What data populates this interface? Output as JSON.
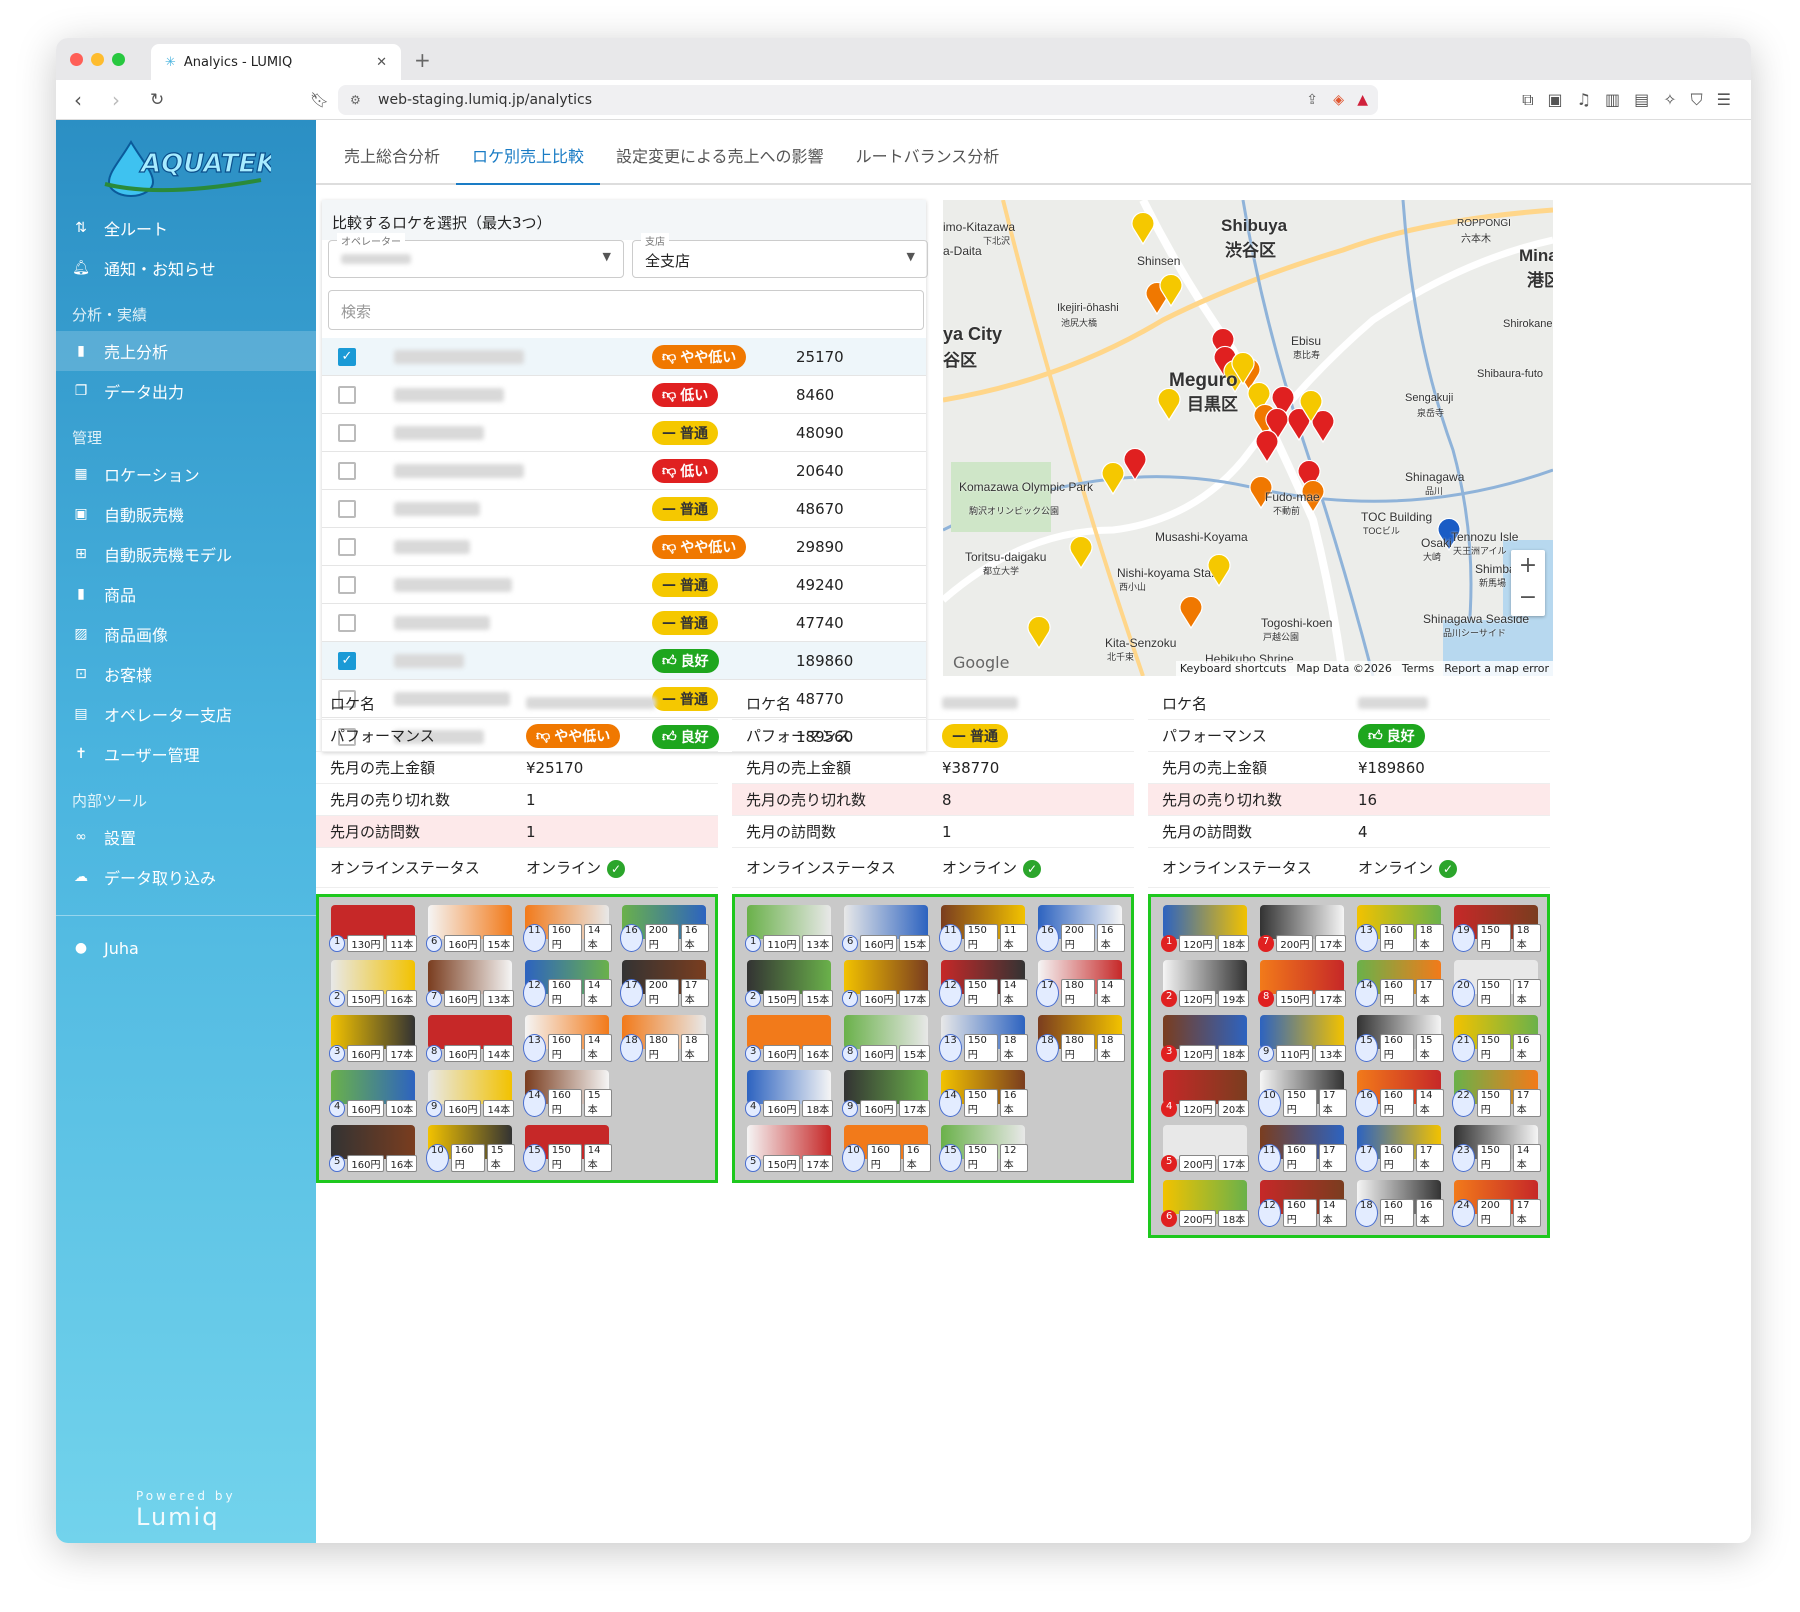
{
  "browser": {
    "tab_title": "Analyics - LUMIQ",
    "url": "web-staging.lumiq.jp/analytics"
  },
  "sidebar": {
    "logo_text": "AQUATEK",
    "items_top": [
      {
        "label": "全ルート",
        "icon": "route-icon"
      },
      {
        "label": "通知・お知らせ",
        "icon": "bell-icon"
      }
    ],
    "section_analysis": "分析・実績",
    "items_analysis": [
      {
        "label": "売上分析",
        "icon": "bar-chart-icon",
        "active": true
      },
      {
        "label": "データ出力",
        "icon": "copy-icon"
      }
    ],
    "section_manage": "管理",
    "items_manage": [
      {
        "label": "ロケーション",
        "icon": "building-icon"
      },
      {
        "label": "自動販売機",
        "icon": "vending-icon"
      },
      {
        "label": "自動販売機モデル",
        "icon": "grid-icon"
      },
      {
        "label": "商品",
        "icon": "bottle-icon"
      },
      {
        "label": "商品画像",
        "icon": "image-icon"
      },
      {
        "label": "お客様",
        "icon": "briefcase-icon"
      },
      {
        "label": "オペレーター支店",
        "icon": "office-icon"
      },
      {
        "label": "ユーザー管理",
        "icon": "person-icon"
      }
    ],
    "section_internal": "内部ツール",
    "items_internal": [
      {
        "label": "設置",
        "icon": "link-icon"
      },
      {
        "label": "データ取り込み",
        "icon": "cloud-upload-icon"
      }
    ],
    "user": "Juha",
    "powered_by": "Powered by",
    "powered_brand": "Lumiq"
  },
  "tabs": [
    "売上総合分析",
    "ロケ別売上比較",
    "設定変更による売上への影響",
    "ルートバランス分析"
  ],
  "active_tab": 1,
  "selector": {
    "heading": "比較するロケを選択（最大3つ）",
    "operator_label": "オペレーター",
    "branch_label": "支店",
    "branch_value": "全支店",
    "search_placeholder": "検索"
  },
  "location_rows": [
    {
      "checked": true,
      "perf": "やや低い",
      "perf_class": "b-yl",
      "sales": "25170"
    },
    {
      "checked": false,
      "perf": "低い",
      "perf_class": "b-lo",
      "sales": "8460"
    },
    {
      "checked": false,
      "perf": "普通",
      "perf_class": "b-nm",
      "sales": "48090"
    },
    {
      "checked": false,
      "perf": "低い",
      "perf_class": "b-lo",
      "sales": "20640"
    },
    {
      "checked": false,
      "perf": "普通",
      "perf_class": "b-nm",
      "sales": "48670"
    },
    {
      "checked": false,
      "perf": "やや低い",
      "perf_class": "b-yl",
      "sales": "29890"
    },
    {
      "checked": false,
      "perf": "普通",
      "perf_class": "b-nm",
      "sales": "49240"
    },
    {
      "checked": false,
      "perf": "普通",
      "perf_class": "b-nm",
      "sales": "47740"
    },
    {
      "checked": true,
      "perf": "良好",
      "perf_class": "b-gd",
      "sales": "189860"
    },
    {
      "checked": false,
      "perf": "普通",
      "perf_class": "b-nm",
      "sales": "48770"
    },
    {
      "checked": false,
      "perf": "良好",
      "perf_class": "b-gd",
      "sales": "189560"
    }
  ],
  "map": {
    "labels": [
      "Shibuya",
      "渋谷区",
      "Meguro",
      "目黒区",
      "Minato",
      "港区",
      "ROPPONGI",
      "六本木",
      "Shinsen",
      "Ikejiri-ōhashi",
      "池尻大橋",
      "Ebisu",
      "恵比寿",
      "Shirokanedai",
      "Sengakuji",
      "泉岳寺",
      "Shibaura-futo",
      "Shinagawa",
      "品川",
      "Komazawa Olympic Park",
      "駒沢オリンピック公園",
      "Fudo-mae",
      "不動前",
      "Musashi-Koyama",
      "Toritsu-daigaku",
      "都立大学",
      "Nishi-koyama Sta.",
      "西小山",
      "TOC Building",
      "TOCビル",
      "Osaki",
      "大崎",
      "Tennozu Isle",
      "天王洲アイル",
      "Togoshi-koen",
      "戸越公園",
      "Kita-Senzoku",
      "北千束",
      "Hebikubo Shrine",
      "Shinagawa Seaside",
      "品川シーサイド",
      "Shimbamba",
      "新馬場",
      "imo-Kitazawa",
      "下北沢",
      "a-Daita",
      "ya City",
      "谷区"
    ],
    "footer": [
      "Keyboard shortcuts",
      "Map Data ©2026",
      "Terms",
      "Report a map error"
    ],
    "google": "Google",
    "zoom_in": "+",
    "zoom_out": "−"
  },
  "compare_labels": {
    "name": "ロケ名",
    "performance": "パフォーマンス",
    "sales": "先月の売上金額",
    "soldout": "先月の売り切れ数",
    "visits": "先月の訪問数",
    "online": "オンラインステータス"
  },
  "comparisons": [
    {
      "perf": "やや低い",
      "perf_class": "b-yl",
      "sales": "¥25170",
      "soldout": "1",
      "visits": "1",
      "online": "オンライン",
      "pink": "visits",
      "cols": 4,
      "slots": [
        [
          "1",
          "130円",
          "11本"
        ],
        [
          "6",
          "160円",
          "15本"
        ],
        [
          "11",
          "160円",
          "14本"
        ],
        [
          "16",
          "200円",
          "16本"
        ],
        [
          "2",
          "150円",
          "16本"
        ],
        [
          "7",
          "160円",
          "13本"
        ],
        [
          "12",
          "160円",
          "14本"
        ],
        [
          "17",
          "200円",
          "17本"
        ],
        [
          "3",
          "160円",
          "17本"
        ],
        [
          "8",
          "160円",
          "14本"
        ],
        [
          "13",
          "160円",
          "14本"
        ],
        [
          "18",
          "180円",
          "18本"
        ],
        [
          "4",
          "160円",
          "10本"
        ],
        [
          "9",
          "160円",
          "14本"
        ],
        [
          "14",
          "160円",
          "15本"
        ],
        null,
        [
          "5",
          "160円",
          "16本"
        ],
        [
          "10",
          "160円",
          "15本"
        ],
        [
          "15",
          "150円",
          "14本"
        ],
        null
      ]
    },
    {
      "perf": "普通",
      "perf_class": "b-nm",
      "sales": "¥38770",
      "soldout": "8",
      "visits": "1",
      "online": "オンライン",
      "pink": "soldout",
      "cols": 4,
      "slots": [
        [
          "1",
          "110円",
          "13本"
        ],
        [
          "6",
          "160円",
          "15本"
        ],
        [
          "11",
          "150円",
          "11本"
        ],
        [
          "16",
          "200円",
          "16本"
        ],
        [
          "2",
          "150円",
          "15本"
        ],
        [
          "7",
          "160円",
          "17本"
        ],
        [
          "12",
          "150円",
          "14本"
        ],
        [
          "17",
          "180円",
          "14本"
        ],
        [
          "3",
          "160円",
          "16本"
        ],
        [
          "8",
          "160円",
          "15本"
        ],
        [
          "13",
          "150円",
          "18本"
        ],
        [
          "18",
          "180円",
          "18本"
        ],
        [
          "4",
          "160円",
          "18本"
        ],
        [
          "9",
          "160円",
          "17本"
        ],
        [
          "14",
          "150円",
          "16本"
        ],
        null,
        [
          "5",
          "150円",
          "17本"
        ],
        [
          "10",
          "160円",
          "16本"
        ],
        [
          "15",
          "150円",
          "12本"
        ],
        null
      ]
    },
    {
      "perf": "良好",
      "perf_class": "b-gd",
      "sales": "¥189860",
      "soldout": "16",
      "visits": "4",
      "online": "オンライン",
      "pink": "soldout",
      "cols": 4,
      "slots": [
        [
          "1",
          "120円",
          "18本"
        ],
        [
          "7",
          "200円",
          "17本"
        ],
        [
          "13",
          "160円",
          "18本"
        ],
        [
          "19",
          "150円",
          "18本"
        ],
        [
          "2",
          "120円",
          "19本"
        ],
        [
          "8",
          "150円",
          "17本"
        ],
        [
          "14",
          "160円",
          "17本"
        ],
        [
          "20",
          "150円",
          "17本"
        ],
        [
          "3",
          "120円",
          "18本"
        ],
        [
          "9",
          "110円",
          "13本"
        ],
        [
          "15",
          "160円",
          "15本"
        ],
        [
          "21",
          "150円",
          "16本"
        ],
        [
          "4",
          "120円",
          "20本"
        ],
        [
          "10",
          "150円",
          "17本"
        ],
        [
          "16",
          "160円",
          "14本"
        ],
        [
          "22",
          "150円",
          "17本"
        ],
        [
          "5",
          "200円",
          "17本"
        ],
        [
          "11",
          "160円",
          "17本"
        ],
        [
          "17",
          "160円",
          "17本"
        ],
        [
          "23",
          "150円",
          "14本"
        ],
        [
          "6",
          "200円",
          "18本"
        ],
        [
          "12",
          "160円",
          "14本"
        ],
        [
          "18",
          "160円",
          "16本"
        ],
        [
          "24",
          "200円",
          "17本"
        ]
      ]
    }
  ],
  "colors": {
    "accent": "#1a7cc5",
    "frame": "#1ec81e",
    "soldout_red": "#e02020"
  }
}
